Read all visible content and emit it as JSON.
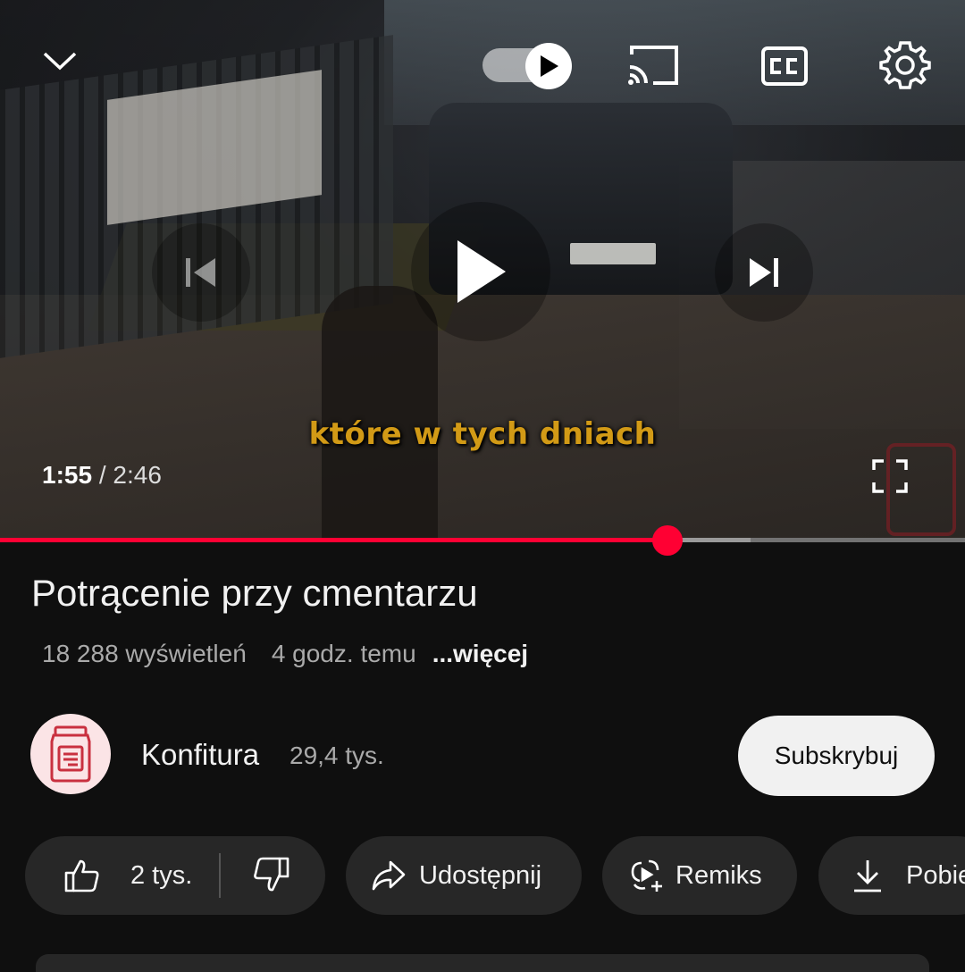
{
  "player": {
    "subtitle": "które w tych dniach",
    "current_time": "1:55",
    "time_separator": "/",
    "duration": "2:46",
    "progress_fraction": 0.692,
    "buffered_fraction": 0.778,
    "icons": [
      "chevron-down-icon",
      "autoplay-toggle",
      "cast-icon",
      "closed-captions-icon",
      "gear-icon",
      "previous-icon",
      "play-icon",
      "next-icon",
      "fullscreen-icon"
    ]
  },
  "video": {
    "title": "Potrącenie przy cmentarzu",
    "views": "18 288 wyświetleń",
    "age": "4 godz. temu",
    "more_label": "...więcej"
  },
  "channel": {
    "name": "Konfitura",
    "subscribers": "29,4 tys.",
    "subscribe_label": "Subskrybuj"
  },
  "actions": {
    "like_count": "2 tys.",
    "share_label": "Udostępnij",
    "remix_label": "Remiks",
    "download_label": "Pobierz"
  },
  "colors": {
    "accent": "#ff0033",
    "background": "#0f0f0f",
    "chip": "#272727",
    "subtitle": "#d29a16"
  }
}
